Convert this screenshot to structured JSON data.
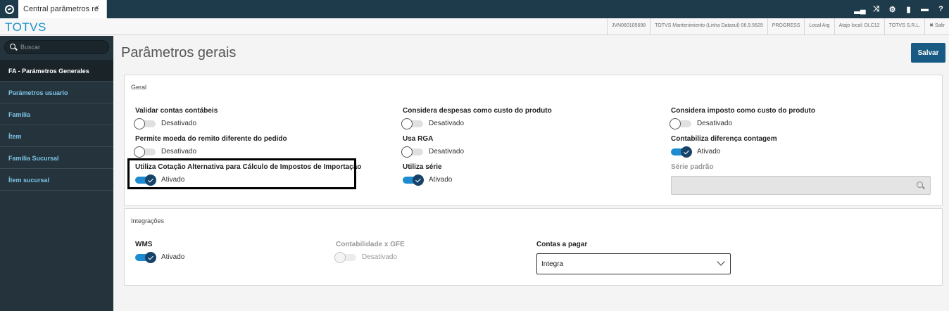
{
  "topbar": {
    "tab_label": "Central parâmetros re",
    "tab_close": "×",
    "tools": [
      "signal-icon",
      "shuffle-icon",
      "gear-icon",
      "document-icon",
      "chat-icon",
      "help-icon"
    ]
  },
  "header": {
    "brand": "TOTVS",
    "info": [
      "JVN060105698",
      "TOTVS Mantenimiento (Linha Datasul) 06.9.5629",
      "PROGRESS",
      "Local Arg",
      "Atajo local: DLC12",
      "TOTVS S.R.L.",
      "✖ Salir"
    ]
  },
  "sidebar": {
    "search_placeholder": "Buscar",
    "items": [
      {
        "label": "FA - Parámetros Generales",
        "active": true
      },
      {
        "label": "Parámetros usuario",
        "active": false
      },
      {
        "label": "Familia",
        "active": false
      },
      {
        "label": "Ítem",
        "active": false
      },
      {
        "label": "Familia Sucursal",
        "active": false
      },
      {
        "label": "Ítem sucursal",
        "active": false
      }
    ]
  },
  "main": {
    "title": "Parâmetros gerais",
    "save_label": "Salvar",
    "geral": {
      "title": "Geral",
      "fields": [
        {
          "label": "Validar contas contábeis",
          "state": "Desativado",
          "on": false
        },
        {
          "label": "Considera despesas como custo do produto",
          "state": "Desativado",
          "on": false
        },
        {
          "label": "Considera imposto como custo do produto",
          "state": "Desativado",
          "on": false
        },
        {
          "label": "Permite moeda do remito diferente do pedido",
          "state": "Desativado",
          "on": false
        },
        {
          "label": "Usa RGA",
          "state": "Desativado",
          "on": false
        },
        {
          "label": "Contabiliza diferença contagem",
          "state": "Ativado",
          "on": true
        },
        {
          "label": "Utiliza Cotação Alternativa para Cálculo de Impostos de Importação",
          "state": "Ativado",
          "on": true
        },
        {
          "label": "Utiliza série",
          "state": "Ativado",
          "on": true
        }
      ],
      "serie_padrao_label": "Série padrão",
      "serie_padrao_value": ""
    },
    "integracoes": {
      "title": "Integrações",
      "wms_label": "WMS",
      "wms_state": "Ativado",
      "gfe_label": "Contabilidade x GFE",
      "gfe_state": "Desativado",
      "contas_label": "Contas a pagar",
      "contas_value": "Integra"
    }
  },
  "colors": {
    "topbar": "#1e3b4c",
    "sidebar": "#25343c",
    "accent": "#1790c9",
    "toggle_on": "#1e8bd0",
    "save_button": "#175a83"
  }
}
